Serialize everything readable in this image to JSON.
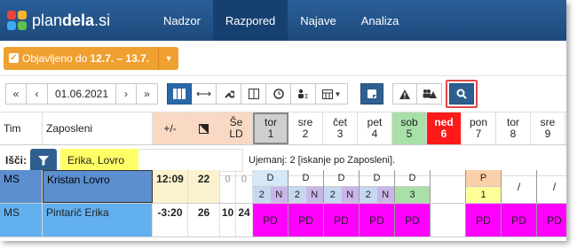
{
  "app": {
    "logo_prefix": "plan",
    "logo_bold": "dela",
    "logo_suffix": ".si"
  },
  "nav": {
    "items": [
      "Nadzor",
      "Razpored",
      "Najave",
      "Analiza"
    ],
    "active": "Razpored"
  },
  "publish": {
    "label_prefix": "Objavljeno do ",
    "label_range": "12.7. – 13.7."
  },
  "toolbar": {
    "date": "01.06.2021",
    "first": "«",
    "prev": "‹",
    "next": "›",
    "last": "»"
  },
  "columns": {
    "tim": "Tim",
    "zaposleni": "Zaposleni",
    "plusminus": "+/-",
    "se_line1": "Še",
    "se_line2": "LD"
  },
  "days": [
    {
      "name": "tor",
      "num": "1"
    },
    {
      "name": "sre",
      "num": "2"
    },
    {
      "name": "čet",
      "num": "3"
    },
    {
      "name": "pet",
      "num": "4"
    },
    {
      "name": "sob",
      "num": "5"
    },
    {
      "name": "ned",
      "num": "6"
    },
    {
      "name": "pon",
      "num": "7"
    },
    {
      "name": "tor",
      "num": "8"
    },
    {
      "name": "sre",
      "num": "9"
    }
  ],
  "filter": {
    "label": "Išči:",
    "value": "Erika, Lovro",
    "status": "Ujemanj: 2 [iskanje po Zaposleni]."
  },
  "rows": [
    {
      "tim": "MS",
      "name": "Kristan Lovro",
      "plusminus": "12:09",
      "col2": "22",
      "col3": "0",
      "col4": "0",
      "shifts": [
        [
          "D",
          "2",
          "N"
        ],
        [
          "D",
          "2",
          "N"
        ],
        [
          "D",
          "2",
          "N"
        ],
        [
          "D",
          "2",
          "N"
        ],
        [
          "D",
          "3",
          ""
        ],
        [
          "",
          ""
        ],
        [
          "P",
          "1",
          ""
        ],
        [
          "/",
          ""
        ],
        [
          "/",
          ""
        ]
      ]
    },
    {
      "tim": "MS",
      "name": "Pintarič Erika",
      "plusminus": "-3:20",
      "col2": "26",
      "col3": "10",
      "col4": "24",
      "shifts": [
        "PD",
        "PD",
        "PD",
        "PD",
        "PD",
        "",
        "PD",
        "PD",
        "PD"
      ]
    }
  ]
}
